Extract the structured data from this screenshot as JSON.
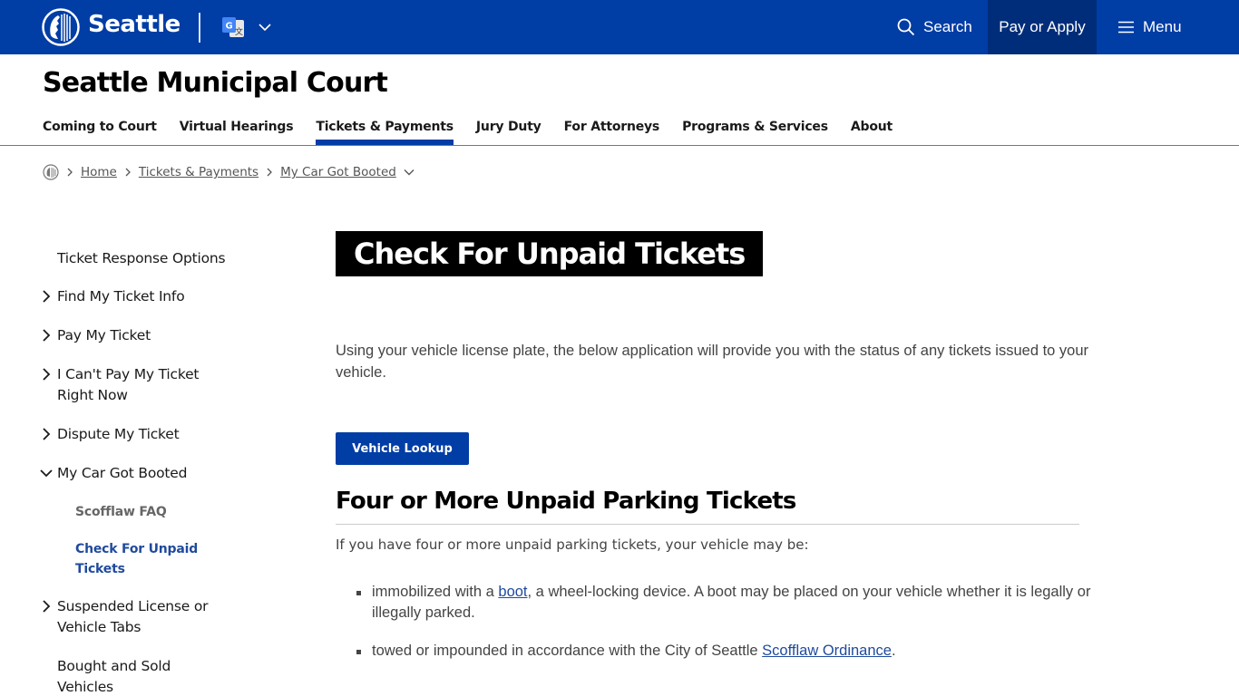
{
  "topbar": {
    "brand": "Seattle",
    "logo_icon": "seattle-seal-icon",
    "translate_icon": "google-translate-icon",
    "search_label": "Search",
    "pay_label": "Pay or Apply",
    "menu_label": "Menu",
    "colors": {
      "bar": "#003da5",
      "pay_bg": "#002d7a"
    }
  },
  "header": {
    "site_title": "Seattle Municipal Court",
    "nav": [
      {
        "label": "Coming to Court",
        "active": false
      },
      {
        "label": "Virtual Hearings",
        "active": false
      },
      {
        "label": "Tickets & Payments",
        "active": true
      },
      {
        "label": "Jury Duty",
        "active": false
      },
      {
        "label": "For Attorneys",
        "active": false
      },
      {
        "label": "Programs & Services",
        "active": false
      },
      {
        "label": "About",
        "active": false
      }
    ]
  },
  "breadcrumb": {
    "home_icon": "seattle-seal-icon",
    "items": [
      "Home",
      "Tickets & Payments",
      "My Car Got Booted"
    ]
  },
  "sidebar": {
    "items": [
      {
        "label": "Ticket Response Options",
        "chevron": "none"
      },
      {
        "label": "Find My Ticket Info",
        "chevron": "right"
      },
      {
        "label": "Pay My Ticket",
        "chevron": "right"
      },
      {
        "label": "I Can't Pay My Ticket Right Now",
        "chevron": "right"
      },
      {
        "label": "Dispute My Ticket",
        "chevron": "right"
      },
      {
        "label": "My Car Got Booted",
        "chevron": "down"
      },
      {
        "label": "Suspended License or Vehicle Tabs",
        "chevron": "right"
      },
      {
        "label": "Bought and Sold Vehicles",
        "chevron": "none"
      }
    ],
    "sub_items": [
      {
        "label": "Scofflaw FAQ",
        "current": false
      },
      {
        "label": "Check For Unpaid Tickets",
        "current": true
      }
    ]
  },
  "main": {
    "title": "Check For Unpaid Tickets",
    "intro": "Using your vehicle license plate, the below application will provide you with the status of any tickets issued to your vehicle.",
    "button_label": "Vehicle Lookup",
    "section_heading": "Four or More Unpaid Parking Tickets",
    "section_text": "If you have four or more unpaid parking tickets, your vehicle may be:",
    "bullets": [
      {
        "before": "immobilized with a ",
        "link": "boot",
        "after": ", a wheel-locking device. A boot may be placed on your vehicle whether it is legally or illegally parked."
      },
      {
        "before": "towed or impounded in accordance with the City of Seattle ",
        "link": "Scofflaw Ordinance",
        "after": "."
      }
    ]
  }
}
